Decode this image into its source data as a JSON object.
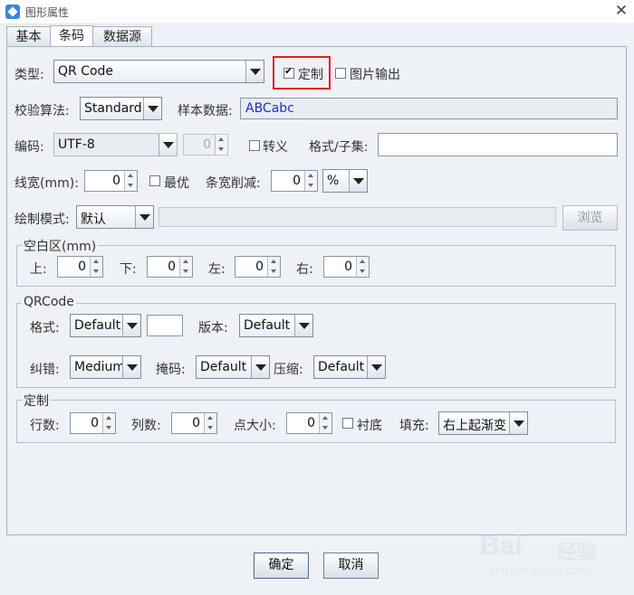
{
  "window": {
    "title": "图形属性",
    "close_glyph": "✕"
  },
  "tabs": [
    {
      "label": "基本"
    },
    {
      "label": "条码"
    },
    {
      "label": "数据源"
    }
  ],
  "type_row": {
    "label": "类型:",
    "value": "QR Code",
    "custom_label": "定制",
    "custom_checked": true,
    "image_output_label": "图片输出",
    "image_output_checked": false
  },
  "check_row": {
    "label": "校验算法:",
    "value": "Standard",
    "sample_label": "样本数据:",
    "sample_value": "ABCabc"
  },
  "encoding_row": {
    "label": "编码:",
    "value": "UTF-8",
    "disabled_spin": "0",
    "escape_label": "转义",
    "format_label": "格式/子集:",
    "format_value": ""
  },
  "linewidth_row": {
    "label": "线宽(mm):",
    "value": "0",
    "optimal_label": "最优",
    "reduce_label": "条宽削减:",
    "reduce_value": "0",
    "unit_value": "%"
  },
  "draw_row": {
    "label": "绘制模式:",
    "value": "默认",
    "browse_label": "浏览"
  },
  "blank_group": {
    "title": "空白区(mm)",
    "top_label": "上:",
    "top": "0",
    "bottom_label": "下:",
    "bottom": "0",
    "left_label": "左:",
    "left": "0",
    "right_label": "右:",
    "right": "0"
  },
  "qr_group": {
    "title": "QRCode",
    "format_label": "格式:",
    "format_value": "Default",
    "version_label": "版本:",
    "version_value": "Default",
    "ec_label": "纠错:",
    "ec_value": "Medium",
    "mask_label": "掩码:",
    "mask_value": "Default",
    "compress_label": "压缩:",
    "compress_value": "Default"
  },
  "custom_group": {
    "title": "定制",
    "rows_label": "行数:",
    "rows": "0",
    "cols_label": "列数:",
    "cols": "0",
    "dot_label": "点大小:",
    "dot": "0",
    "bg_label": "衬底",
    "fill_label": "填充:",
    "fill_value": "右上起渐变"
  },
  "buttons": {
    "ok": "确定",
    "cancel": "取消"
  },
  "watermark": {
    "line1": "Bai",
    "line2": "经验",
    "line3": "jingyan.baidu.com"
  }
}
